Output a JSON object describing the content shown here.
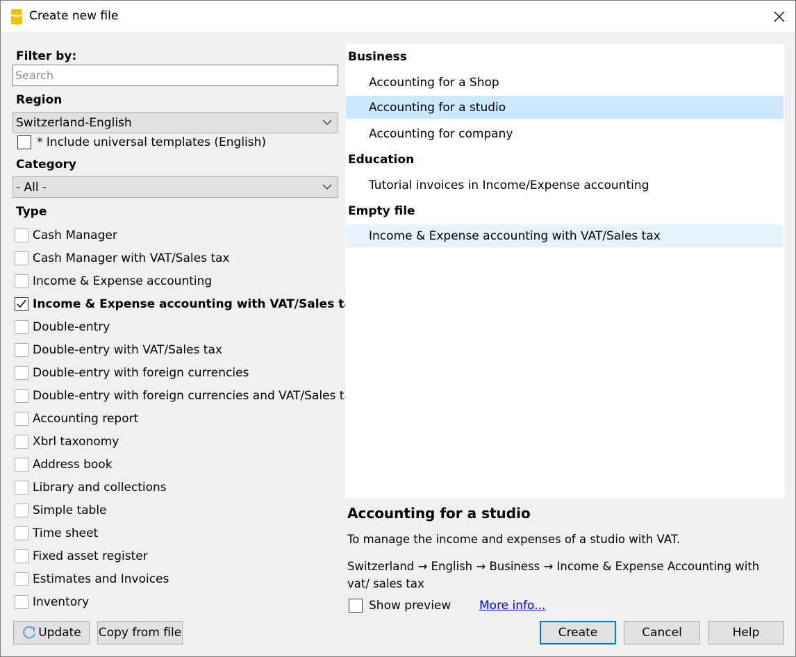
{
  "window": {
    "title": "Create new file",
    "accent_color": "#0078d7",
    "app_icon_color": "#f5c000"
  },
  "filter": {
    "label": "Filter by:",
    "search_placeholder": "Search",
    "search_value": ""
  },
  "region": {
    "label": "Region",
    "selected": "Switzerland-English",
    "universal_templates_label": "* Include universal templates (English)",
    "universal_templates_checked": false
  },
  "category": {
    "label": "Category",
    "selected": "- All -"
  },
  "type": {
    "label": "Type",
    "items": [
      {
        "label": "Cash Manager",
        "checked": false
      },
      {
        "label": "Cash Manager with VAT/Sales tax",
        "checked": false
      },
      {
        "label": "Income & Expense accounting",
        "checked": false
      },
      {
        "label": "Income & Expense accounting with VAT/Sales tax",
        "checked": true
      },
      {
        "label": "Double-entry",
        "checked": false
      },
      {
        "label": "Double-entry with VAT/Sales tax",
        "checked": false
      },
      {
        "label": "Double-entry with foreign currencies",
        "checked": false
      },
      {
        "label": "Double-entry with foreign currencies and VAT/Sales tax",
        "checked": false
      },
      {
        "label": "Accounting report",
        "checked": false
      },
      {
        "label": "Xbrl taxonomy",
        "checked": false
      },
      {
        "label": "Address book",
        "checked": false
      },
      {
        "label": "Library and collections",
        "checked": false
      },
      {
        "label": "Simple table",
        "checked": false
      },
      {
        "label": "Time sheet",
        "checked": false
      },
      {
        "label": "Fixed asset register",
        "checked": false
      },
      {
        "label": "Estimates and Invoices",
        "checked": false
      },
      {
        "label": "Inventory",
        "checked": false
      }
    ]
  },
  "templates": {
    "groups": [
      {
        "name": "Business",
        "items": [
          "Accounting for a Shop",
          "Accounting for a studio",
          "Accounting for company"
        ]
      },
      {
        "name": "Education",
        "items": [
          "Tutorial invoices in Income/Expense accounting"
        ]
      },
      {
        "name": "Empty file",
        "items": [
          "Income & Expense accounting with VAT/Sales tax"
        ]
      }
    ],
    "selected": "Accounting for a studio"
  },
  "detail": {
    "title": "Accounting for a studio",
    "description": "To manage the income and expenses of a studio with VAT.",
    "path": "Switzerland → English → Business → Income & Expense Accounting with vat/ sales tax",
    "show_preview_label": "Show preview",
    "show_preview_checked": false,
    "more_info_label": "More info..."
  },
  "buttons": {
    "update": "Update",
    "copy_from_file": "Copy from file",
    "create": "Create",
    "cancel": "Cancel",
    "help": "Help"
  }
}
